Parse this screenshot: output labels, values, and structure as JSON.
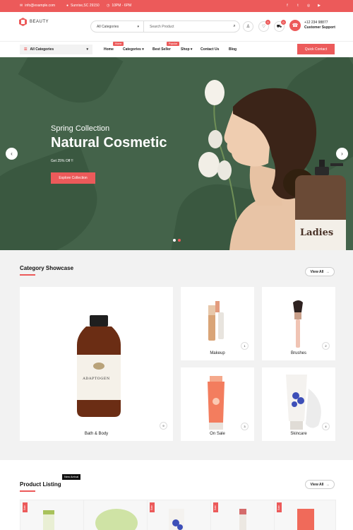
{
  "topbar": {
    "email": "info@example.com",
    "location": "Sunrise,SC 29150",
    "hours": "10PM - 6PM",
    "social_icons": [
      "facebook-icon",
      "twitter-icon",
      "instagram-icon",
      "youtube-icon"
    ]
  },
  "header": {
    "logo_text": "BEAUTY",
    "search_category": "All Categories",
    "search_placeholder": "Search Product",
    "wishlist_count": "0",
    "cart_count": "0",
    "support_phone": "+12 234 98877",
    "support_label": "Customer Support"
  },
  "nav": {
    "all_categories": "All Categories",
    "items": [
      {
        "label": "Home",
        "tag": "Home"
      },
      {
        "label": "Categories",
        "tag": ""
      },
      {
        "label": "Best Seller",
        "tag": "Popular"
      },
      {
        "label": "Shop",
        "tag": ""
      },
      {
        "label": "Contact Us",
        "tag": ""
      },
      {
        "label": "Blog",
        "tag": ""
      }
    ],
    "quick_contact": "Quick Contact"
  },
  "hero": {
    "subtitle": "Spring Collection",
    "title": "Natural Cosmetic",
    "offer": "Get 25% Off !!",
    "button": "Explore Collection",
    "bottle_label": "Ladies",
    "slide_count": 2,
    "active_slide": 1
  },
  "category_section": {
    "title": "Category Showcase",
    "view_all": "View All",
    "featured": {
      "label": "Bath & Body",
      "count": "9",
      "bottle_brand": "ADAPTOGEN"
    },
    "items": [
      {
        "label": "Makeup",
        "count": "1"
      },
      {
        "label": "Brushes",
        "count": "2"
      },
      {
        "label": "On Sale",
        "count": "3"
      },
      {
        "label": "Skincare",
        "count": "4"
      }
    ]
  },
  "product_section": {
    "title": "Product Listing",
    "tag": "New Arrival",
    "view_all": "View All",
    "sale_label": "Sale"
  },
  "colors": {
    "accent": "#ec5a5a",
    "hero_bg": "#44634a"
  }
}
